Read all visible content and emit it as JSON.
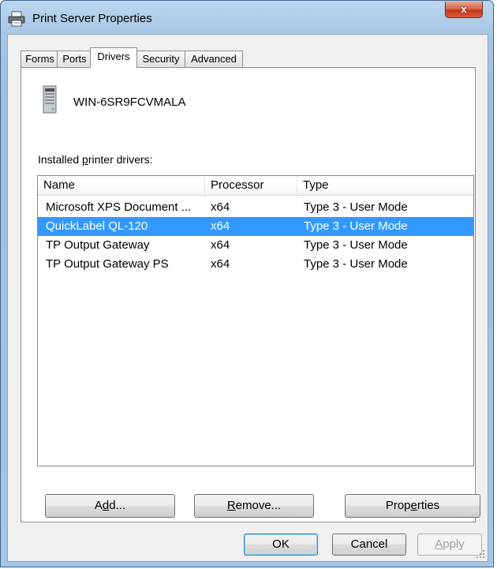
{
  "window": {
    "title": "Print Server Properties",
    "close_glyph": "x",
    "title_icon": "printer-icon"
  },
  "tabs": [
    {
      "label": "Forms",
      "active": false
    },
    {
      "label": "Ports",
      "active": false
    },
    {
      "label": "Drivers",
      "active": true
    },
    {
      "label": "Security",
      "active": false
    },
    {
      "label": "Advanced",
      "active": false
    }
  ],
  "server": {
    "icon": "server-icon",
    "name": "WIN-6SR9FCVMALA"
  },
  "drivers": {
    "label_pre": "Installed ",
    "label_underline": "p",
    "label_post": "rinter drivers:",
    "columns": [
      "Name",
      "Processor",
      "Type"
    ],
    "rows": [
      {
        "name": "Microsoft XPS Document ...",
        "processor": "x64",
        "type": "Type 3 - User Mode",
        "selected": false
      },
      {
        "name": "QuickLabel QL-120",
        "processor": "x64",
        "type": "Type 3 - User Mode",
        "selected": true
      },
      {
        "name": "TP Output Gateway",
        "processor": "x64",
        "type": "Type 3 - User Mode",
        "selected": false
      },
      {
        "name": "TP Output Gateway PS",
        "processor": "x64",
        "type": "Type 3 - User Mode",
        "selected": false
      }
    ]
  },
  "actions": {
    "add": {
      "pre": "A",
      "u": "d",
      "post": "d..."
    },
    "remove": {
      "pre": "",
      "u": "R",
      "post": "emove..."
    },
    "properties": {
      "pre": "Prop",
      "u": "e",
      "post": "rties"
    }
  },
  "footer": {
    "ok": "OK",
    "cancel": "Cancel",
    "apply": {
      "pre": "",
      "u": "A",
      "post": "pply"
    }
  },
  "colors": {
    "selection": "#3399ff",
    "close_button": "#c4391d",
    "frame": "#a9c7e6"
  }
}
